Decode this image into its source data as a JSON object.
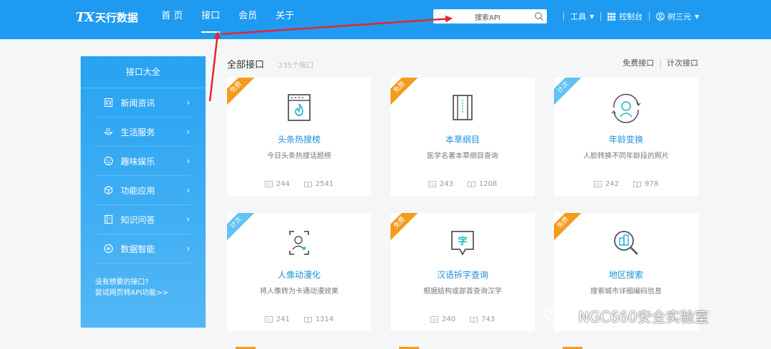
{
  "header": {
    "logo_mark": "TX",
    "logo_text": "天行数据",
    "nav": [
      {
        "label": "首 页"
      },
      {
        "label": "接口"
      },
      {
        "label": "会员"
      },
      {
        "label": "关于"
      }
    ],
    "active_nav": "接口",
    "search_placeholder": "搜索API",
    "tools_label": "工具",
    "console_label": "控制台",
    "user_label": "树三元"
  },
  "sidebar": {
    "title": "接口大全",
    "items": [
      {
        "label": "新闻资讯",
        "icon": "news-icon"
      },
      {
        "label": "生活服务",
        "icon": "life-service-icon"
      },
      {
        "label": "趣味娱乐",
        "icon": "smiley-icon"
      },
      {
        "label": "功能应用",
        "icon": "cube-icon"
      },
      {
        "label": "知识问答",
        "icon": "question-book-icon"
      },
      {
        "label": "数据智能",
        "icon": "ai-icon"
      }
    ],
    "footer_line1": "没有想要的接口?",
    "footer_line2": "尝试网页转API功能>>"
  },
  "main": {
    "title": "全部接口",
    "count": "235个接口",
    "filter_free": "免费接口",
    "filter_count": "计次接口",
    "cards": [
      {
        "name": "头条热搜榜",
        "desc": "今日头条热搜话题榜",
        "badge": "免费",
        "badge_type": "free",
        "id": "244",
        "views": "2541",
        "icon": "hot-list-icon"
      },
      {
        "name": "本草纲目",
        "desc": "医学名著本草纲目查询",
        "badge": "免费",
        "badge_type": "free",
        "id": "243",
        "views": "1208",
        "icon": "book-icon"
      },
      {
        "name": "年龄变换",
        "desc": "人脸转换不同年龄段的照片",
        "badge": "计次",
        "badge_type": "count",
        "id": "242",
        "views": "978",
        "icon": "face-age-icon"
      },
      {
        "name": "人像动漫化",
        "desc": "将人像转为卡通动漫效果",
        "badge": "计次",
        "badge_type": "count",
        "id": "241",
        "views": "1314",
        "icon": "portrait-icon"
      },
      {
        "name": "汉语拆字查询",
        "desc": "根据结构或部首查询汉字",
        "badge": "免费",
        "badge_type": "free",
        "id": "240",
        "views": "743",
        "icon": "character-icon"
      },
      {
        "name": "地区搜索",
        "desc": "搜索城市详细编码信息",
        "badge": "免费",
        "badge_type": "free",
        "id": "",
        "views": "",
        "icon": "region-search-icon"
      }
    ]
  },
  "watermark": "NGC660安全实验室",
  "colors": {
    "header": "#1e9bf0",
    "free": "#f59b1c",
    "count": "#62c2f3",
    "link": "#1e8fd8",
    "arrow": "#e8242c"
  }
}
